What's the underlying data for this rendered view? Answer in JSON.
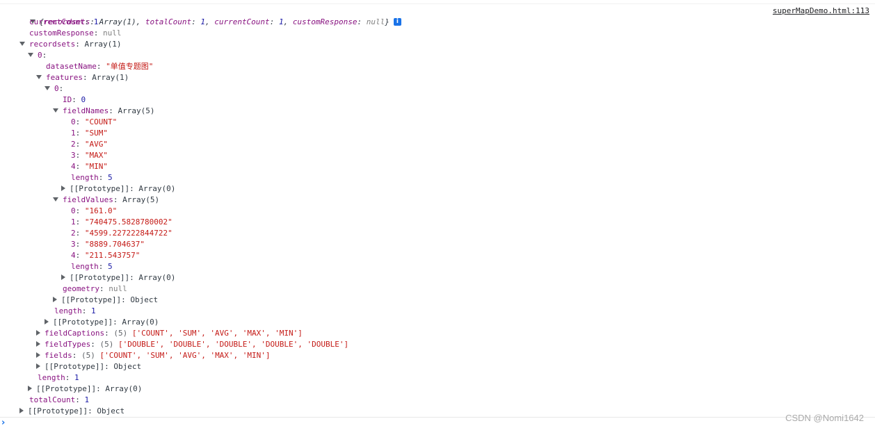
{
  "source_link": "superMapDemo.html:113",
  "summary": {
    "open": "{",
    "recordsets_key": "recordsets",
    "recordsets_val": "Array(1)",
    "totalCount_key": "totalCount",
    "totalCount_val": "1",
    "currentCount_key": "currentCount",
    "currentCount_val": "1",
    "customResponse_key": "customResponse",
    "customResponse_val": "null",
    "close": "}",
    "info_icon": "i"
  },
  "tree": {
    "currentCount": {
      "key": "currentCount",
      "value": "1"
    },
    "customResponse": {
      "key": "customResponse",
      "value": "null"
    },
    "recordsets": {
      "key": "recordsets",
      "value": "Array(1)"
    },
    "rs0": {
      "key": "0"
    },
    "datasetName": {
      "key": "datasetName",
      "value": "\"单值专题图\""
    },
    "features": {
      "key": "features",
      "value": "Array(1)"
    },
    "feat0": {
      "key": "0"
    },
    "ID": {
      "key": "ID",
      "value": "0"
    },
    "fieldNames": {
      "key": "fieldNames",
      "value": "Array(5)",
      "items": [
        {
          "key": "0",
          "value": "\"COUNT\""
        },
        {
          "key": "1",
          "value": "\"SUM\""
        },
        {
          "key": "2",
          "value": "\"AVG\""
        },
        {
          "key": "3",
          "value": "\"MAX\""
        },
        {
          "key": "4",
          "value": "\"MIN\""
        }
      ],
      "length_key": "length",
      "length": "5",
      "proto_key": "[[Prototype]]",
      "proto": "Array(0)"
    },
    "fieldValues": {
      "key": "fieldValues",
      "value": "Array(5)",
      "items": [
        {
          "key": "0",
          "value": "\"161.0\""
        },
        {
          "key": "1",
          "value": "\"740475.5828780002\""
        },
        {
          "key": "2",
          "value": "\"4599.227222844722\""
        },
        {
          "key": "3",
          "value": "\"8889.704637\""
        },
        {
          "key": "4",
          "value": "\"211.543757\""
        }
      ],
      "length_key": "length",
      "length": "5",
      "proto_key": "[[Prototype]]",
      "proto": "Array(0)"
    },
    "geometry": {
      "key": "geometry",
      "value": "null"
    },
    "feat0_proto": {
      "key": "[[Prototype]]",
      "value": "Object"
    },
    "features_length": {
      "key": "length",
      "value": "1"
    },
    "features_proto": {
      "key": "[[Prototype]]",
      "value": "Array(0)"
    },
    "fieldCaptions": {
      "key": "fieldCaptions",
      "count": "(5)",
      "value": "['COUNT', 'SUM', 'AVG', 'MAX', 'MIN']"
    },
    "fieldTypes": {
      "key": "fieldTypes",
      "count": "(5)",
      "value": "['DOUBLE', 'DOUBLE', 'DOUBLE', 'DOUBLE', 'DOUBLE']"
    },
    "fields": {
      "key": "fields",
      "count": "(5)",
      "value": "['COUNT', 'SUM', 'AVG', 'MAX', 'MIN']"
    },
    "rs0_proto": {
      "key": "[[Prototype]]",
      "value": "Object"
    },
    "recordsets_length": {
      "key": "length",
      "value": "1"
    },
    "recordsets_proto": {
      "key": "[[Prototype]]",
      "value": "Array(0)"
    },
    "totalCount": {
      "key": "totalCount",
      "value": "1"
    },
    "root_proto": {
      "key": "[[Prototype]]",
      "value": "Object"
    }
  },
  "prompt_caret": "›",
  "watermark": "CSDN @Nomi1642",
  "colors": {
    "key": "#881280",
    "number": "#1a1aa6",
    "string": "#c41a16",
    "null": "#808080",
    "link": "#202124",
    "info_icon": "#1a73e8"
  }
}
